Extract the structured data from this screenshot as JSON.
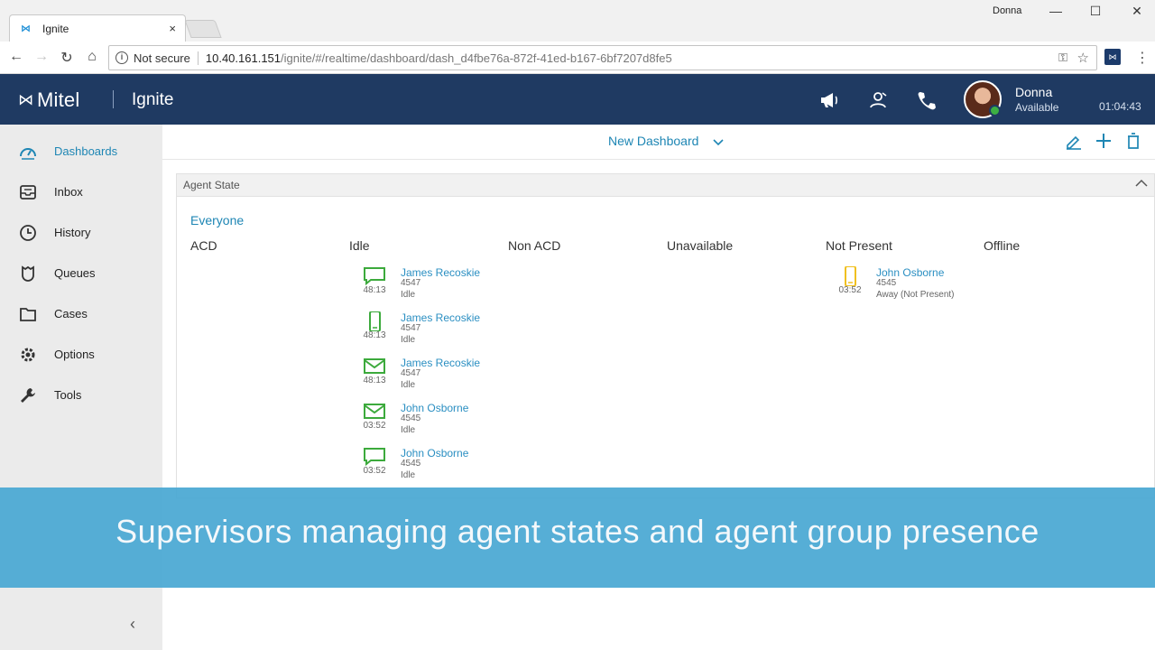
{
  "browser": {
    "tab_title": "Ignite",
    "tab_close": "×",
    "window_user": "Donna",
    "security": "Not secure",
    "url_host": "10.40.161.151",
    "url_path": "/ignite/#/realtime/dashboard/dash_d4fbe76a-872f-41ed-b167-6bf7207d8fe5",
    "ext_label": "⋈"
  },
  "header": {
    "brand": "Mitel",
    "app_name": "Ignite",
    "user_name": "Donna",
    "user_status": "Available",
    "timer": "01:04:43"
  },
  "sidebar": {
    "items": [
      {
        "label": "Dashboards",
        "icon": "gauge-icon"
      },
      {
        "label": "Inbox",
        "icon": "inbox-icon"
      },
      {
        "label": "History",
        "icon": "clock-icon"
      },
      {
        "label": "Queues",
        "icon": "queue-icon"
      },
      {
        "label": "Cases",
        "icon": "folder-icon"
      },
      {
        "label": "Options",
        "icon": "gear-icon"
      },
      {
        "label": "Tools",
        "icon": "wrench-icon"
      }
    ],
    "collapse_glyph": "‹"
  },
  "dashboard": {
    "title": "New Dashboard",
    "panel_title": "Agent State",
    "group": "Everyone",
    "columns": [
      "ACD",
      "Idle",
      "Non ACD",
      "Unavailable",
      "Not Present",
      "Offline"
    ],
    "idle_agents": [
      {
        "name": "James Recoskie",
        "ext": "4547",
        "state": "Idle",
        "time": "48:13",
        "icon": "chat-icon"
      },
      {
        "name": "James Recoskie",
        "ext": "4547",
        "state": "Idle",
        "time": "48:13",
        "icon": "phone-icon"
      },
      {
        "name": "James Recoskie",
        "ext": "4547",
        "state": "Idle",
        "time": "48:13",
        "icon": "email-icon"
      },
      {
        "name": "John Osborne",
        "ext": "4545",
        "state": "Idle",
        "time": "03:52",
        "icon": "email-icon"
      },
      {
        "name": "John Osborne",
        "ext": "4545",
        "state": "Idle",
        "time": "03:52",
        "icon": "chat-icon"
      }
    ],
    "not_present_agents": [
      {
        "name": "John Osborne",
        "ext": "4545",
        "state": "Away (Not Present)",
        "time": "03:52",
        "icon": "phone-icon"
      }
    ]
  },
  "banner": {
    "text": "Supervisors managing agent states and agent group presence"
  },
  "colors": {
    "header_bg": "#1f3a62",
    "accent": "#1e86b4",
    "idle_green": "#3caa3c",
    "away_yellow": "#f0c020",
    "banner": "#49a8d3"
  }
}
